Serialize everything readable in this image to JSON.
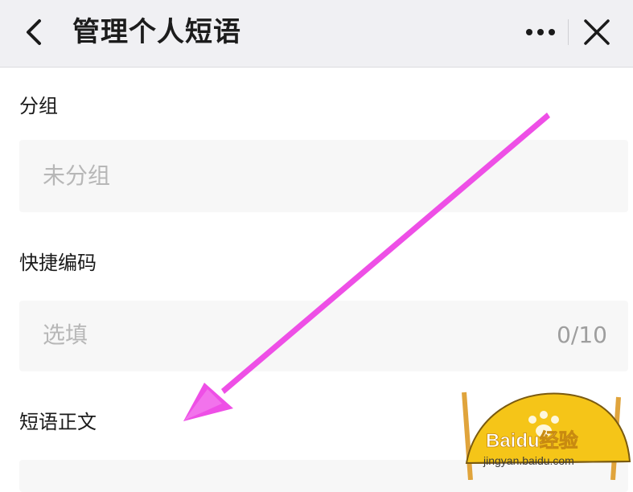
{
  "header": {
    "title": "管理个人短语",
    "back_icon": "chevron-left-icon",
    "more_icon": "more-horizontal-icon",
    "close_icon": "close-icon"
  },
  "form": {
    "group": {
      "label": "分组",
      "placeholder": "未分组"
    },
    "shortcut": {
      "label": "快捷编码",
      "placeholder": "选填",
      "counter": "0/10"
    },
    "body": {
      "label": "短语正文"
    }
  },
  "annotation": {
    "arrow_color": "#ee4fe6"
  },
  "watermark": {
    "brand": "Baidu经验",
    "url": "jingyan.baidu.com",
    "color": "#f5c518"
  },
  "colors": {
    "header_bg": "#f0f0f3",
    "field_bg": "#f7f7f7"
  }
}
